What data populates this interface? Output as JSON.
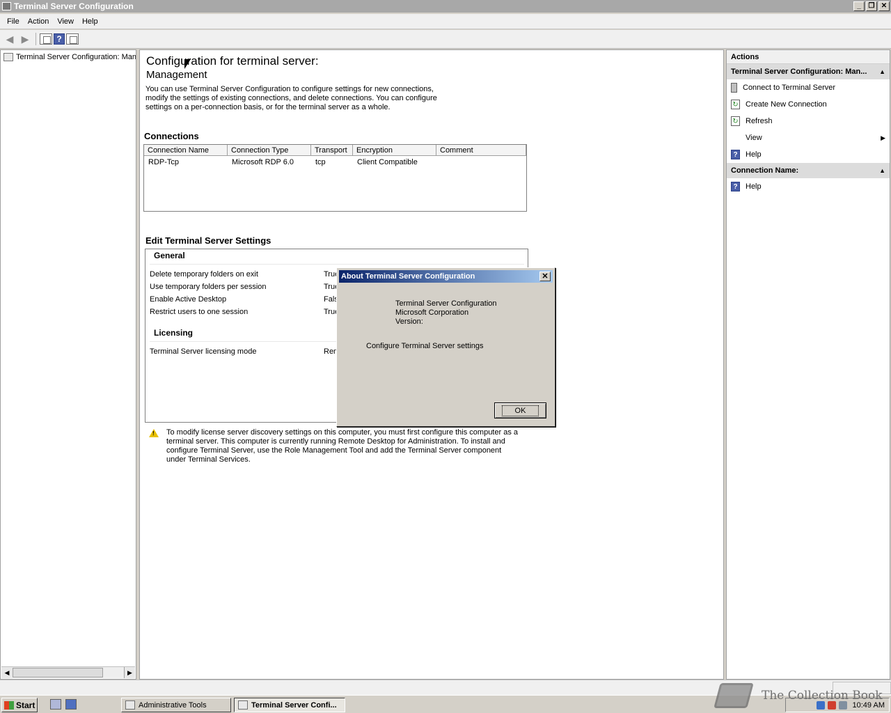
{
  "window": {
    "title": "Terminal Server Configuration",
    "controls": {
      "minimize": "_",
      "restore": "❐",
      "close": "✕"
    }
  },
  "menu": {
    "items": [
      "File",
      "Action",
      "View",
      "Help"
    ]
  },
  "toolbar": {
    "icons": [
      "back-arrow-icon",
      "forward-arrow-icon",
      "show-hide-tree-icon",
      "help-icon",
      "show-hide-action-pane-icon"
    ],
    "help_glyph": "?"
  },
  "tree": {
    "root_label": "Terminal Server Configuration: Man",
    "scroll_left": "◀",
    "scroll_right": "▶"
  },
  "main": {
    "title": "Configuration for terminal server:",
    "subtitle": "Management",
    "description": "You can use Terminal Server Configuration to configure settings for new connections, modify the settings of existing connections, and delete connections. You can configure settings on a per-connection basis, or for the terminal server as a whole.",
    "connections": {
      "heading": "Connections",
      "columns": [
        "Connection Name",
        "Connection Type",
        "Transport",
        "Encryption",
        "Comment"
      ],
      "rows": [
        [
          "RDP-Tcp",
          "Microsoft RDP 6.0",
          "tcp",
          "Client Compatible",
          ""
        ]
      ]
    },
    "settings": {
      "heading": "Edit Terminal Server Settings",
      "general_heading": "General",
      "general": [
        {
          "label": "Delete temporary folders on exit",
          "value": "True"
        },
        {
          "label": "Use temporary folders per session",
          "value": "True"
        },
        {
          "label": "Enable Active Desktop",
          "value": "Fals"
        },
        {
          "label": "Restrict users to one session",
          "value": "True"
        }
      ],
      "licensing_heading": "Licensing",
      "licensing": [
        {
          "label": "Terminal Server licensing mode",
          "value": "Rem"
        }
      ]
    },
    "warning": {
      "icon": "warning-icon",
      "glyph": "!",
      "text": "To modify license server discovery settings on this computer, you must first configure this computer as a terminal server. This computer is currently running Remote Desktop for Administration. To install and configure Terminal Server, use the Role Management Tool and add the Terminal Server component under Terminal Services."
    }
  },
  "actions": {
    "header": "Actions",
    "section1": "Terminal Server Configuration: Man...",
    "section1_items": [
      {
        "label": "Connect to Terminal Server",
        "icon": "server-icon"
      },
      {
        "label": "Create New Connection",
        "icon": "new-connection-icon"
      },
      {
        "label": "Refresh",
        "icon": "refresh-icon"
      },
      {
        "label": "View",
        "icon": ""
      },
      {
        "label": "Help",
        "icon": "help-icon"
      }
    ],
    "section2": "Connection Name:",
    "section2_items": [
      {
        "label": "Help",
        "icon": "help-icon"
      }
    ],
    "collapse_glyph": "▲",
    "submenu_glyph": "▶",
    "help_glyph": "?",
    "doc_glyph": "↻"
  },
  "dialog": {
    "title": "About Terminal Server Configuration",
    "product": "Terminal Server Configuration",
    "company": "Microsoft Corporation",
    "version": "Version:",
    "description": "Configure Terminal Server settings",
    "ok_label": "OK",
    "close_glyph": "✕"
  },
  "taskbar": {
    "start_label": "Start",
    "tasks": [
      {
        "label": "Administrative Tools",
        "active": false
      },
      {
        "label": "Terminal Server Confi...",
        "active": true
      }
    ],
    "clock": "10:49 AM"
  },
  "watermark": {
    "text": "The Collection Book"
  },
  "colors": {
    "titlebar_inactive": "#a8a8a8",
    "dialog_title_start": "#0a246a",
    "dialog_title_end": "#a6caf0",
    "warning_yellow": "#e8c000"
  }
}
